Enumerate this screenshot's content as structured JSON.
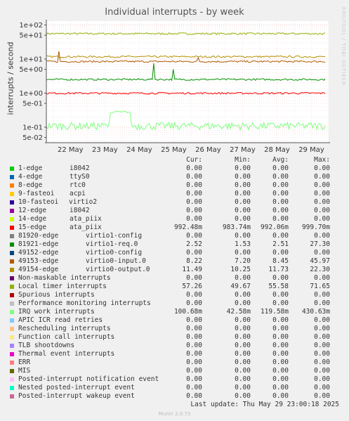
{
  "title": "Individual interrupts - by week",
  "side_label": "RRDTOOL / TOBI OETIKER",
  "footer": {
    "last_update": "Last update: Thu May 29 23:00:18 2025",
    "version": "Munin 2.0.73"
  },
  "legend_headers": {
    "cur": "Cur:",
    "min": "Min:",
    "avg": "Avg:",
    "max": "Max:"
  },
  "colors": {
    "bg": "#f0f0f0",
    "plot_bg": "#ffffff",
    "grid": "#e0a0a0",
    "axis": "#555555"
  },
  "chart_data": {
    "type": "line",
    "title": "Individual interrupts - by week",
    "ylabel": "interrupts / second",
    "y_scale": "log",
    "ylim": [
      0.035,
      130
    ],
    "y_ticks": [
      {
        "v": 100,
        "label": "1e+02"
      },
      {
        "v": 50,
        "label": "5e+01"
      },
      {
        "v": 10,
        "label": "1e+01"
      },
      {
        "v": 5,
        "label": "5e+00"
      },
      {
        "v": 1,
        "label": "1e+00"
      },
      {
        "v": 0.5,
        "label": "5e-01"
      },
      {
        "v": 0.1,
        "label": "1e-01"
      },
      {
        "v": 0.05,
        "label": "5e-02"
      }
    ],
    "x_ticks": [
      "22 May",
      "23 May",
      "24 May",
      "25 May",
      "26 May",
      "27 May",
      "28 May",
      "29 May"
    ],
    "grid": true,
    "series": [
      {
        "name": "1-edge",
        "detail": "i8042",
        "color": "#00cc00",
        "cur": "0.00",
        "min": "0.00",
        "avg": "0.00",
        "max": "0.00"
      },
      {
        "name": "4-edge",
        "detail": "ttyS0",
        "color": "#0066b3",
        "cur": "0.00",
        "min": "0.00",
        "avg": "0.00",
        "max": "0.00"
      },
      {
        "name": "8-edge",
        "detail": "rtc0",
        "color": "#ff8000",
        "cur": "0.00",
        "min": "0.00",
        "avg": "0.00",
        "max": "0.00"
      },
      {
        "name": "9-fasteoi",
        "detail": "acpi",
        "color": "#ffcc00",
        "cur": "0.00",
        "min": "0.00",
        "avg": "0.00",
        "max": "0.00"
      },
      {
        "name": "10-fasteoi",
        "detail": "virtio2",
        "color": "#330099",
        "cur": "0.00",
        "min": "0.00",
        "avg": "0.00",
        "max": "0.00"
      },
      {
        "name": "12-edge",
        "detail": "i8042",
        "color": "#990099",
        "cur": "0.00",
        "min": "0.00",
        "avg": "0.00",
        "max": "0.00"
      },
      {
        "name": "14-edge",
        "detail": "ata_piix",
        "color": "#ccff00",
        "cur": "0.00",
        "min": "0.00",
        "avg": "0.00",
        "max": "0.00"
      },
      {
        "name": "15-edge",
        "detail": "ata_piix",
        "color": "#ff0000",
        "cur": "992.48m",
        "min": "983.74m",
        "avg": "992.06m",
        "max": "999.70m"
      },
      {
        "name": "81920-edge",
        "detail": "virtio1-config",
        "color": "#808080",
        "cur": "0.00",
        "min": "0.00",
        "avg": "0.00",
        "max": "0.00"
      },
      {
        "name": "81921-edge",
        "detail": "virtio1-req.0",
        "color": "#008f00",
        "cur": "2.52",
        "min": "1.53",
        "avg": "2.51",
        "max": "27.30"
      },
      {
        "name": "49152-edge",
        "detail": "virtio0-config",
        "color": "#00487d",
        "cur": "0.00",
        "min": "0.00",
        "avg": "0.00",
        "max": "0.00"
      },
      {
        "name": "49153-edge",
        "detail": "virtio0-input.0",
        "color": "#b35a00",
        "cur": "8.22",
        "min": "7.20",
        "avg": "8.45",
        "max": "45.97"
      },
      {
        "name": "49154-edge",
        "detail": "virtio0-output.0",
        "color": "#b38f00",
        "cur": "11.49",
        "min": "10.25",
        "avg": "11.73",
        "max": "22.30"
      },
      {
        "name": "Non-maskable interrupts",
        "detail": "",
        "color": "#6b006b",
        "cur": "0.00",
        "min": "0.00",
        "avg": "0.00",
        "max": "0.00"
      },
      {
        "name": "Local timer interrupts",
        "detail": "",
        "color": "#8fb300",
        "cur": "57.26",
        "min": "49.67",
        "avg": "55.58",
        "max": "71.65"
      },
      {
        "name": "Spurious interrupts",
        "detail": "",
        "color": "#b30000",
        "cur": "0.00",
        "min": "0.00",
        "avg": "0.00",
        "max": "0.00"
      },
      {
        "name": "Performance monitoring interrupts",
        "detail": "",
        "color": "#bebebe",
        "cur": "0.00",
        "min": "0.00",
        "avg": "0.00",
        "max": "0.00"
      },
      {
        "name": "IRQ work interrupts",
        "detail": "",
        "color": "#80ff80",
        "cur": "100.68m",
        "min": "42.58m",
        "avg": "119.58m",
        "max": "430.63m"
      },
      {
        "name": "APIC ICR read retries",
        "detail": "",
        "color": "#80c9ff",
        "cur": "0.00",
        "min": "0.00",
        "avg": "0.00",
        "max": "0.00"
      },
      {
        "name": "Rescheduling interrupts",
        "detail": "",
        "color": "#ffc080",
        "cur": "0.00",
        "min": "0.00",
        "avg": "0.00",
        "max": "0.00"
      },
      {
        "name": "Function call interrupts",
        "detail": "",
        "color": "#ffe680",
        "cur": "0.00",
        "min": "0.00",
        "avg": "0.00",
        "max": "0.00"
      },
      {
        "name": "TLB shootdowns",
        "detail": "",
        "color": "#aa80ff",
        "cur": "0.00",
        "min": "0.00",
        "avg": "0.00",
        "max": "0.00"
      },
      {
        "name": "Thermal event interrupts",
        "detail": "",
        "color": "#ee00cc",
        "cur": "0.00",
        "min": "0.00",
        "avg": "0.00",
        "max": "0.00"
      },
      {
        "name": "ERR",
        "detail": "",
        "color": "#ff8080",
        "cur": "0.00",
        "min": "0.00",
        "avg": "0.00",
        "max": "0.00"
      },
      {
        "name": "MIS",
        "detail": "",
        "color": "#666600",
        "cur": "0.00",
        "min": "0.00",
        "avg": "0.00",
        "max": "0.00"
      },
      {
        "name": "Posted-interrupt notification event",
        "detail": "",
        "color": "#ffbfff",
        "cur": "0.00",
        "min": "0.00",
        "avg": "0.00",
        "max": "0.00"
      },
      {
        "name": "Nested posted-interrupt event",
        "detail": "",
        "color": "#00ffcc",
        "cur": "0.00",
        "min": "0.00",
        "avg": "0.00",
        "max": "0.00"
      },
      {
        "name": "Posted-interrupt wakeup event",
        "detail": "",
        "color": "#cc6699",
        "cur": "0.00",
        "min": "0.00",
        "avg": "0.00",
        "max": "0.00"
      }
    ],
    "plotted_levels": [
      {
        "series": "Local timer interrupts",
        "base": 55.58,
        "spikes": []
      },
      {
        "series": "49154-edge",
        "base": 11.73,
        "spikes": []
      },
      {
        "series": "49153-edge",
        "base": 8.45,
        "spikes": [
          {
            "day": 0.35,
            "value": 17
          },
          {
            "day": 4.4,
            "value": 11
          }
        ]
      },
      {
        "series": "81921-edge",
        "base": 2.51,
        "spikes": [
          {
            "day": 3.12,
            "value": 7.5
          },
          {
            "day": 3.7,
            "value": 5.0
          }
        ]
      },
      {
        "series": "15-edge",
        "base": 0.992,
        "spikes": []
      },
      {
        "series": "IRQ work interrupts",
        "base": 0.11,
        "spikes": [],
        "bump": {
          "from_day": 1.85,
          "to_day": 2.45,
          "value": 0.28
        }
      }
    ]
  }
}
